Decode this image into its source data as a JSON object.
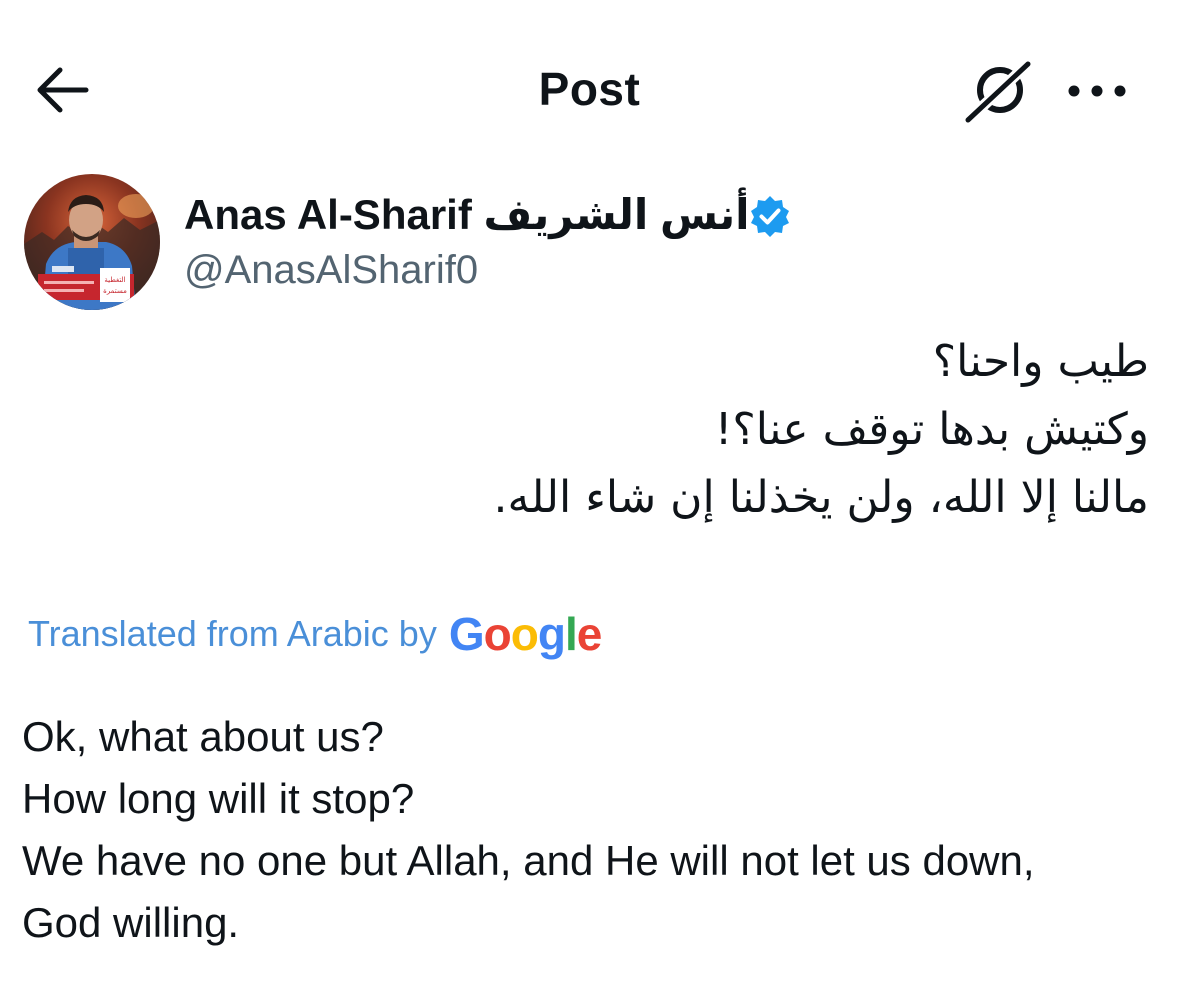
{
  "header": {
    "title": "Post",
    "back_icon": "arrow-left-icon",
    "grok_icon": "grok-icon",
    "more_icon": "more-horizontal-icon"
  },
  "post": {
    "author": {
      "name": "Anas Al-Sharif أنس الشريف",
      "handle": "@AnasAlSharif0",
      "verified": true,
      "verified_color": "#1d9bf0",
      "avatar_caption": "التغطية مستمرة"
    },
    "original_text": [
      "طيب واحنا؟",
      "وكتيش بدها توقف عنا؟!",
      "مالنا إلا الله، ولن يخذلنا إن شاء الله."
    ],
    "translation": {
      "label": "Translated from Arabic by",
      "label_color": "#4a8fd8",
      "provider": "Google",
      "provider_colors": [
        "#4285F4",
        "#EA4335",
        "#FBBC05",
        "#4285F4",
        "#34A853",
        "#EA4335"
      ]
    },
    "translated_text": [
      "Ok, what about us?",
      "How long will it stop?",
      "We have no one but Allah, and He will not let us down,",
      "God willing."
    ]
  }
}
